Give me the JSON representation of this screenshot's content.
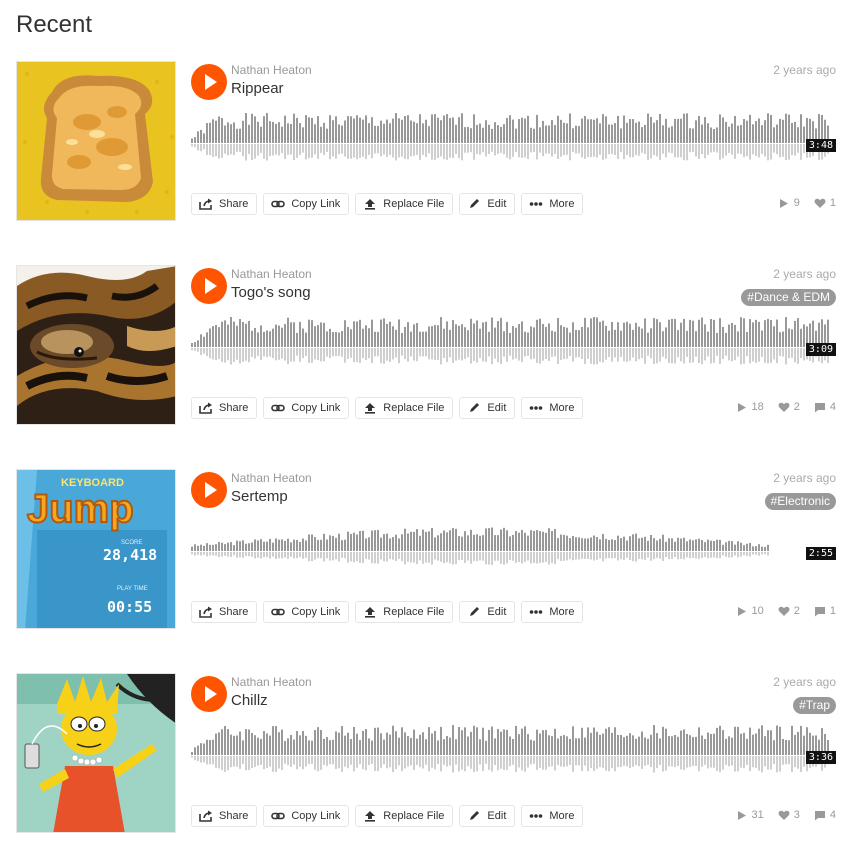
{
  "page": {
    "title": "Recent"
  },
  "actions": {
    "share": "Share",
    "copy_link": "Copy Link",
    "replace_file": "Replace File",
    "edit": "Edit",
    "more": "More"
  },
  "colors": {
    "accent": "#ff5500",
    "waveform": "#999999",
    "tag": "#999999"
  },
  "tracks": [
    {
      "artist": "Nathan Heaton",
      "title": "Rippear",
      "posted": "2 years ago",
      "tag": "",
      "duration": "3:48",
      "plays": "9",
      "likes": "1",
      "comments": "",
      "artwork": "toast"
    },
    {
      "artist": "Nathan Heaton",
      "title": "Togo's song",
      "posted": "2 years ago",
      "tag": "#Dance & EDM",
      "duration": "3:09",
      "plays": "18",
      "likes": "2",
      "comments": "4",
      "artwork": "snake"
    },
    {
      "artist": "Nathan Heaton",
      "title": "Sertemp",
      "posted": "2 years ago",
      "tag": "#Electronic",
      "duration": "2:55",
      "plays": "10",
      "likes": "2",
      "comments": "1",
      "artwork": "keyboard-jump",
      "art_text": {
        "brand": "KEYBOARD",
        "game": "Jump",
        "score_label": "SCORE",
        "score": "28,418",
        "time_label": "PLAY TIME",
        "time": "00:55"
      }
    },
    {
      "artist": "Nathan Heaton",
      "title": "Chillz",
      "posted": "2 years ago",
      "tag": "#Trap",
      "duration": "3:36",
      "plays": "31",
      "likes": "3",
      "comments": "4",
      "artwork": "lisa"
    }
  ]
}
